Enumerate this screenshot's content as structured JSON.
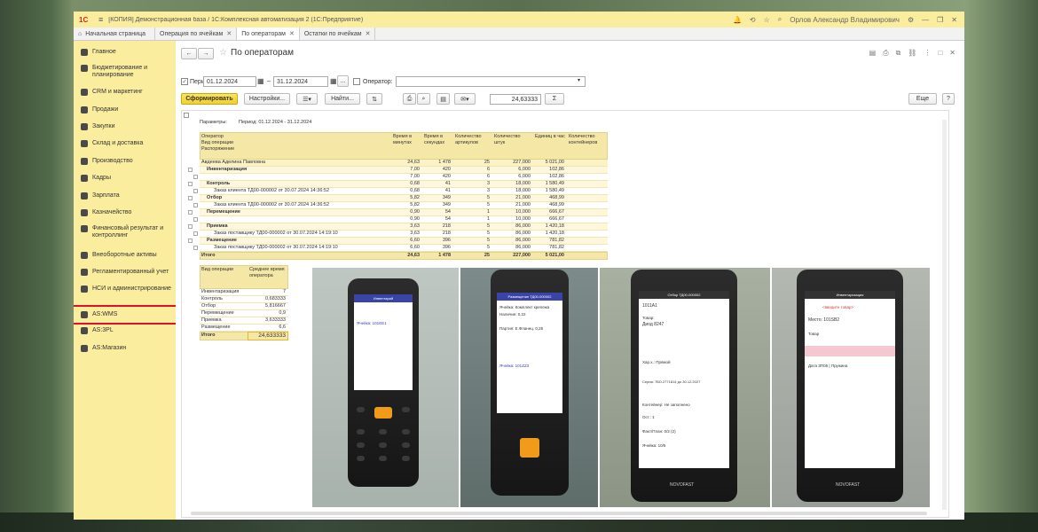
{
  "window": {
    "logo": "1С",
    "title": "[КОПИЯ] Демонстрационная база / 1С:Комплексная автоматизация 2  (1С:Предприятие)",
    "user": "Орлов Александр Владимирович"
  },
  "tabs": [
    {
      "label": "Начальная страница"
    },
    {
      "label": "Операция по ячейкам"
    },
    {
      "label": "По операторам"
    },
    {
      "label": "Остатки по ячейкам"
    }
  ],
  "sidebar": {
    "items": [
      {
        "label": "Главное"
      },
      {
        "label": "Бюджетирование и планирование"
      },
      {
        "label": "CRM и маркетинг"
      },
      {
        "label": "Продажи"
      },
      {
        "label": "Закупки"
      },
      {
        "label": "Склад и доставка"
      },
      {
        "label": "Производство"
      },
      {
        "label": "Кадры"
      },
      {
        "label": "Зарплата"
      },
      {
        "label": "Казначейство"
      },
      {
        "label": "Финансовый результат и контроллинг"
      },
      {
        "label": "Внеоборотные активы"
      },
      {
        "label": "Регламентированный учет"
      },
      {
        "label": "НСИ и администрирование"
      },
      {
        "label": "AS:WMS"
      },
      {
        "label": "AS:3PL"
      },
      {
        "label": "AS:Магазин"
      }
    ]
  },
  "page": {
    "title": "По операторам"
  },
  "form": {
    "period_label": "Период:",
    "date_from": "01.12.2024",
    "date_to": "31.12.2024",
    "dash": "–",
    "ellipsis": "...",
    "operator_label": "Оператор:",
    "operator_value": ""
  },
  "toolbar": {
    "generate": "Сформировать",
    "settings": "Настройки...",
    "find": "Найти...",
    "sum_value": "24,63333",
    "sigma": "Σ",
    "more": "Еще",
    "help": "?"
  },
  "report": {
    "params_label": "Параметры:",
    "params_value": "Период: 01.12.2024 - 31.12.2024",
    "headers": [
      "Оператор",
      "Время в минутах",
      "Время в секундах",
      "Количество артикулов",
      "Количество штук",
      "Единиц в час",
      "Количество контейнеров"
    ],
    "sub_headers": [
      "Вид операции",
      "Распоряжение"
    ],
    "rows": [
      {
        "name": "Авдеева Аделина Павловна",
        "min": "24,63",
        "sec": "1 478",
        "art": "25",
        "qty": "227,000",
        "perh": "5 021,00",
        "lvl": 0
      },
      {
        "name": "Инвентаризация",
        "min": "7,00",
        "sec": "420",
        "art": "6",
        "qty": "6,000",
        "perh": "102,86",
        "lvl": 1
      },
      {
        "name": "",
        "min": "7,00",
        "sec": "420",
        "art": "6",
        "qty": "6,000",
        "perh": "102,86",
        "lvl": 2
      },
      {
        "name": "Контроль",
        "min": "0,68",
        "sec": "41",
        "art": "3",
        "qty": "18,000",
        "perh": "1 580,49",
        "lvl": 1
      },
      {
        "name": "Заказ клиента ТД00-000002 от 30.07.2024 14:36:52",
        "min": "0,68",
        "sec": "41",
        "art": "3",
        "qty": "18,000",
        "perh": "1 580,49",
        "lvl": 2
      },
      {
        "name": "Отбор",
        "min": "5,82",
        "sec": "349",
        "art": "5",
        "qty": "21,000",
        "perh": "468,99",
        "lvl": 1
      },
      {
        "name": "Заказ клиента ТД00-000002 от 30.07.2024 14:36:52",
        "min": "5,82",
        "sec": "349",
        "art": "5",
        "qty": "21,000",
        "perh": "468,99",
        "lvl": 2
      },
      {
        "name": "Перемещение",
        "min": "0,90",
        "sec": "54",
        "art": "1",
        "qty": "10,000",
        "perh": "666,67",
        "lvl": 1
      },
      {
        "name": "",
        "min": "0,90",
        "sec": "54",
        "art": "1",
        "qty": "10,000",
        "perh": "666,67",
        "lvl": 2
      },
      {
        "name": "Приемка",
        "min": "3,63",
        "sec": "218",
        "art": "5",
        "qty": "86,000",
        "perh": "1 420,18",
        "lvl": 1
      },
      {
        "name": "Заказ поставщику ТД00-000002 от 30.07.2024 14:19:10",
        "min": "3,63",
        "sec": "218",
        "art": "5",
        "qty": "86,000",
        "perh": "1 420,18",
        "lvl": 2
      },
      {
        "name": "Размещение",
        "min": "6,60",
        "sec": "396",
        "art": "5",
        "qty": "86,000",
        "perh": "781,82",
        "lvl": 1
      },
      {
        "name": "Заказ поставщику ТД00-000002 от 30.07.2024 14:19:10",
        "min": "6,60",
        "sec": "396",
        "art": "5",
        "qty": "86,000",
        "perh": "781,82",
        "lvl": 2
      }
    ],
    "total": {
      "name": "Итого",
      "min": "24,63",
      "sec": "1 478",
      "art": "25",
      "qty": "227,000",
      "perh": "5 021,00"
    }
  },
  "summary": {
    "headers": [
      "Вид операции",
      "Среднее время оператора"
    ],
    "rows": [
      {
        "op": "Инвентаризация",
        "val": "7"
      },
      {
        "op": "Контроль",
        "val": "0,683333"
      },
      {
        "op": "Отбор",
        "val": "5,816667"
      },
      {
        "op": "Перемещение",
        "val": "0,9"
      },
      {
        "op": "Приемка",
        "val": "3,633333"
      },
      {
        "op": "Размещение",
        "val": "6,6"
      }
    ],
    "total": {
      "op": "Итого",
      "val": "24,633333"
    }
  },
  "phones": {
    "p1": {
      "header": "Инвентарий",
      "line1": "Ячейка: 101ЕЕ1"
    },
    "p2": {
      "header": "Размещение ТД00-000002",
      "line1": "Ячейка: Комплект крепежа",
      "line2": "Наличие: 0,22",
      "line3": "Партия: Е.Фланец. 0,25",
      "line4": "Ячейка: 101ZZ3"
    },
    "p3": {
      "header": "Отбор ТД00-000002",
      "line1": "1011А1",
      "line2": "Товар:",
      "line3": "Диод 8247",
      "line4": "Хар.х.: Прямой",
      "line5": "Серия: 7ВО.2771814 до 30.12.2027",
      "line6": "Контейнер: Не заполнено",
      "line7": "Ост.: 1",
      "line8": "Факт/План: 0/2 (2)",
      "line9": "Ячейка: 10/5",
      "brand": "NOVOFAST"
    },
    "p4": {
      "header": "Инвентаризация",
      "line1": "<введите товар>",
      "line2": "Место: 101SB2",
      "line3": "Товар",
      "line4": "Дата ЗП05 | Пружина",
      "brand": "NOVOFAST"
    }
  }
}
